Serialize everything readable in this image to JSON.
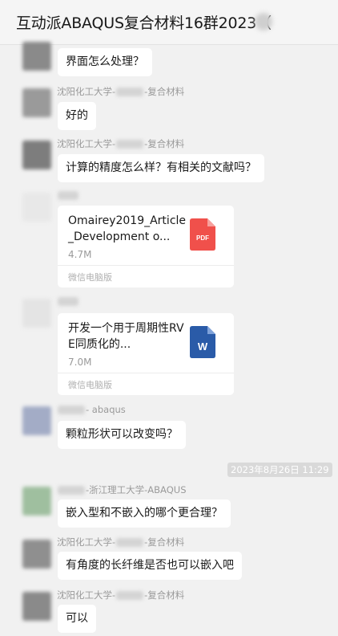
{
  "header": {
    "title": "互动派ABAQUS复合材料16群2023（"
  },
  "messages": [
    {
      "text": "界面怎么处理？"
    },
    {
      "sender_prefix": "沈阳化工大学-",
      "sender_suffix": "-复合材料",
      "text": "好的"
    },
    {
      "sender_prefix": "沈阳化工大学-",
      "sender_suffix": "-复合材料",
      "text": "计算的精度怎么样？有相关的文献吗？"
    },
    {
      "file_name": "Omairey2019_Article_Development o...",
      "file_size": "4.7M",
      "source": "微信电脑版",
      "icon_label": "PDF"
    },
    {
      "file_name": "开发一个用于周期性RVE同质化的...",
      "file_size": "7.0M",
      "source": "微信电脑版",
      "icon_label": "W"
    },
    {
      "sender_suffix": "- abaqus",
      "text": "颗粒形状可以改变吗？"
    },
    {
      "timestamp": "2023年8月26日 11:29"
    },
    {
      "sender_suffix": "-浙江理工大学-ABAQUS",
      "text": "嵌入型和不嵌入的哪个更合理？"
    },
    {
      "sender_prefix": "沈阳化工大学-",
      "sender_suffix": "-复合材料",
      "text": "有角度的长纤维是否也可以嵌入吧"
    },
    {
      "sender_prefix": "沈阳化工大学-",
      "sender_suffix": "-复合材料",
      "text": "可以"
    }
  ],
  "colors": {
    "pdf_icon": "#f0504b",
    "word_icon": "#2a5ba8",
    "bubble": "#ffffff",
    "background": "#f1f1f1"
  },
  "icons": [
    "pdf-file-icon",
    "word-file-icon"
  ]
}
